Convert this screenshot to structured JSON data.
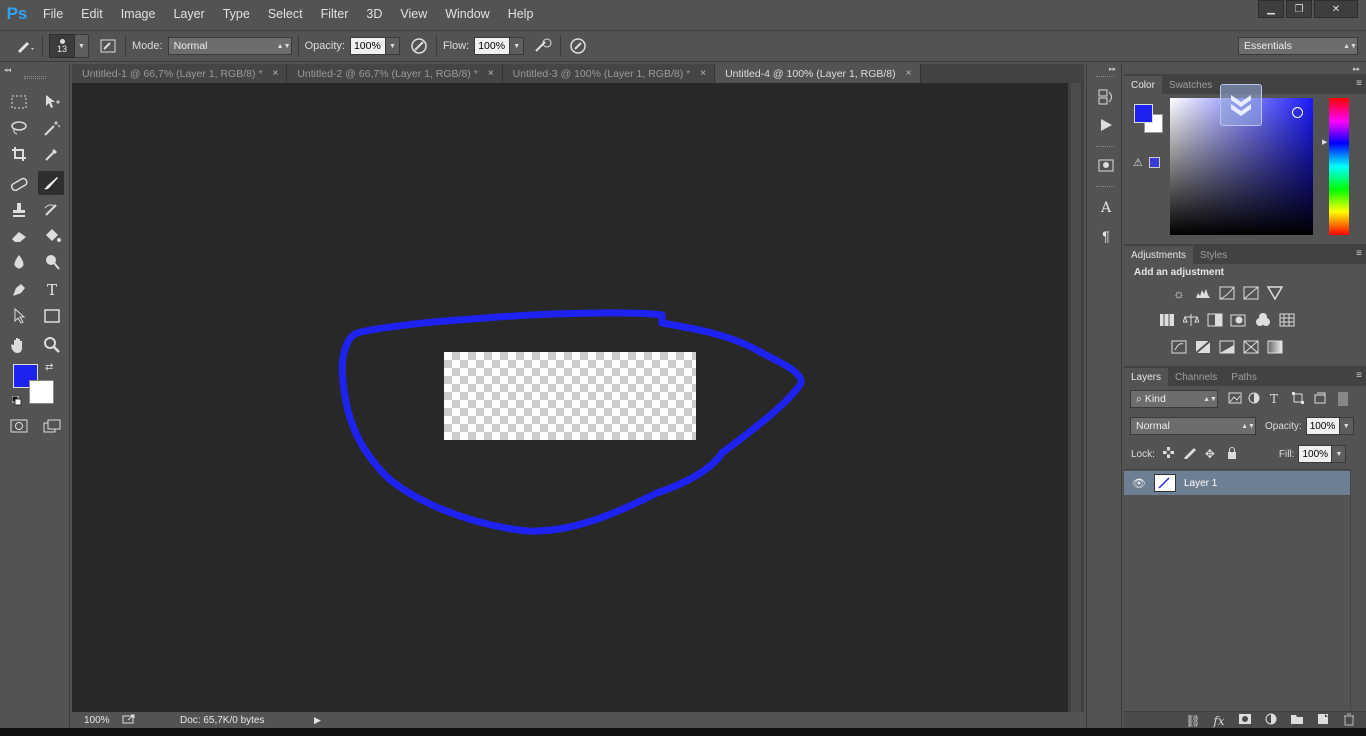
{
  "app": {
    "logo": "Ps"
  },
  "menu": [
    "File",
    "Edit",
    "Image",
    "Layer",
    "Type",
    "Select",
    "Filter",
    "3D",
    "View",
    "Window",
    "Help"
  ],
  "window_controls": {
    "minimize": "▁",
    "restore": "❐",
    "close": "✕"
  },
  "options_bar": {
    "brush_size": "13",
    "mode_label": "Mode:",
    "mode_value": "Normal",
    "opacity_label": "Opacity:",
    "opacity_value": "100%",
    "flow_label": "Flow:",
    "flow_value": "100%",
    "workspace": "Essentials"
  },
  "doc_tabs": [
    {
      "label": "Untitled-1 @ 66,7% (Layer 1, RGB/8) *",
      "close": "×"
    },
    {
      "label": "Untitled-2 @ 66,7% (Layer 1, RGB/8) *",
      "close": "×"
    },
    {
      "label": "Untitled-3 @ 100% (Layer 1, RGB/8) *",
      "close": "×"
    },
    {
      "label": "Untitled-4 @ 100% (Layer 1, RGB/8)",
      "close": "×"
    }
  ],
  "colors": {
    "foreground": "#1e22f0",
    "background": "#ffffff",
    "stroke": "#1e22f0"
  },
  "status": {
    "zoom": "100%",
    "doc_info": "Doc: 65,7K/0 bytes"
  },
  "panels": {
    "color_tabs": [
      "Color",
      "Swatches"
    ],
    "adjust_tabs": [
      "Adjustments",
      "Styles"
    ],
    "adjust_heading": "Add an adjustment",
    "layers_tabs": [
      "Layers",
      "Channels",
      "Paths"
    ],
    "kind_label": "Kind",
    "blend_mode": "Normal",
    "opacity_label": "Opacity:",
    "opacity_value": "100%",
    "lock_label": "Lock:",
    "fill_label": "Fill:",
    "fill_value": "100%",
    "layers": [
      {
        "name": "Layer 1",
        "visible": true
      }
    ]
  },
  "icons": {
    "eye": "👁",
    "panel_menu": "≡"
  }
}
